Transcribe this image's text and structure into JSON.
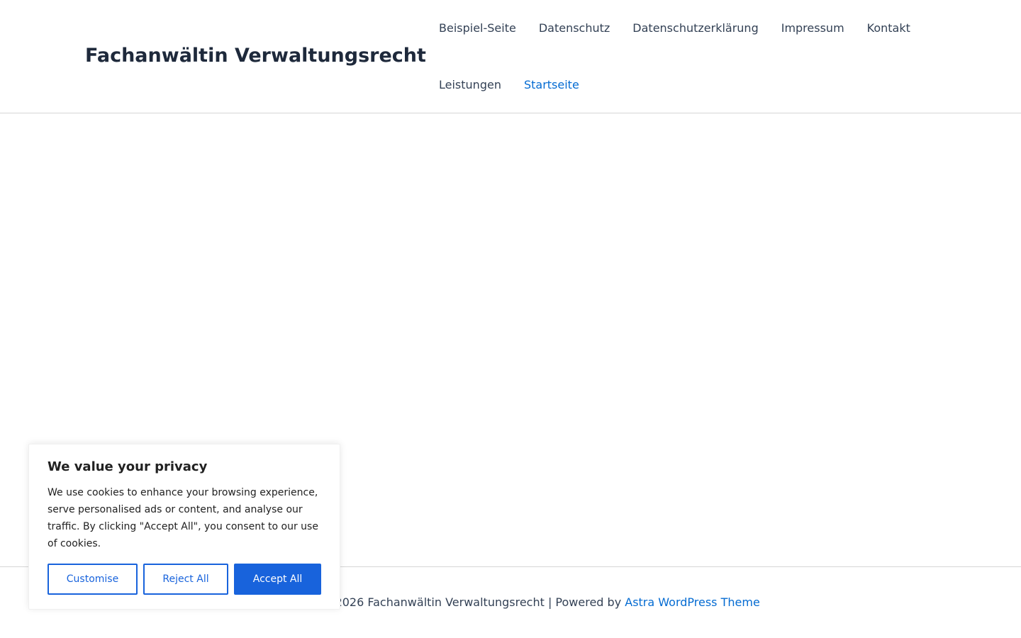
{
  "header": {
    "site_title": "Fachanwältin Verwaltungsrecht",
    "nav": [
      {
        "label": "Beispiel-Seite"
      },
      {
        "label": "Datenschutz"
      },
      {
        "label": "Datenschutzerklärung"
      },
      {
        "label": "Impressum"
      },
      {
        "label": "Kontakt"
      },
      {
        "label": "Leistungen"
      },
      {
        "label": "Startseite",
        "current": true
      }
    ]
  },
  "footer": {
    "copyright": "Copyright © 2026 Fachanwältin Verwaltungsrecht | Powered by ",
    "theme_link": "Astra WordPress Theme"
  },
  "cookie_banner": {
    "title": "We value your privacy",
    "text": "We use cookies to enhance your browsing experience, serve personalised ads or content, and analyse our traffic. By clicking \"Accept All\", you consent to our use of cookies.",
    "customise_label": "Customise",
    "reject_label": "Reject All",
    "accept_label": "Accept All"
  },
  "colors": {
    "accent": "#046bd2",
    "cookie_button": "#1863dc",
    "title": "#1e293b"
  }
}
